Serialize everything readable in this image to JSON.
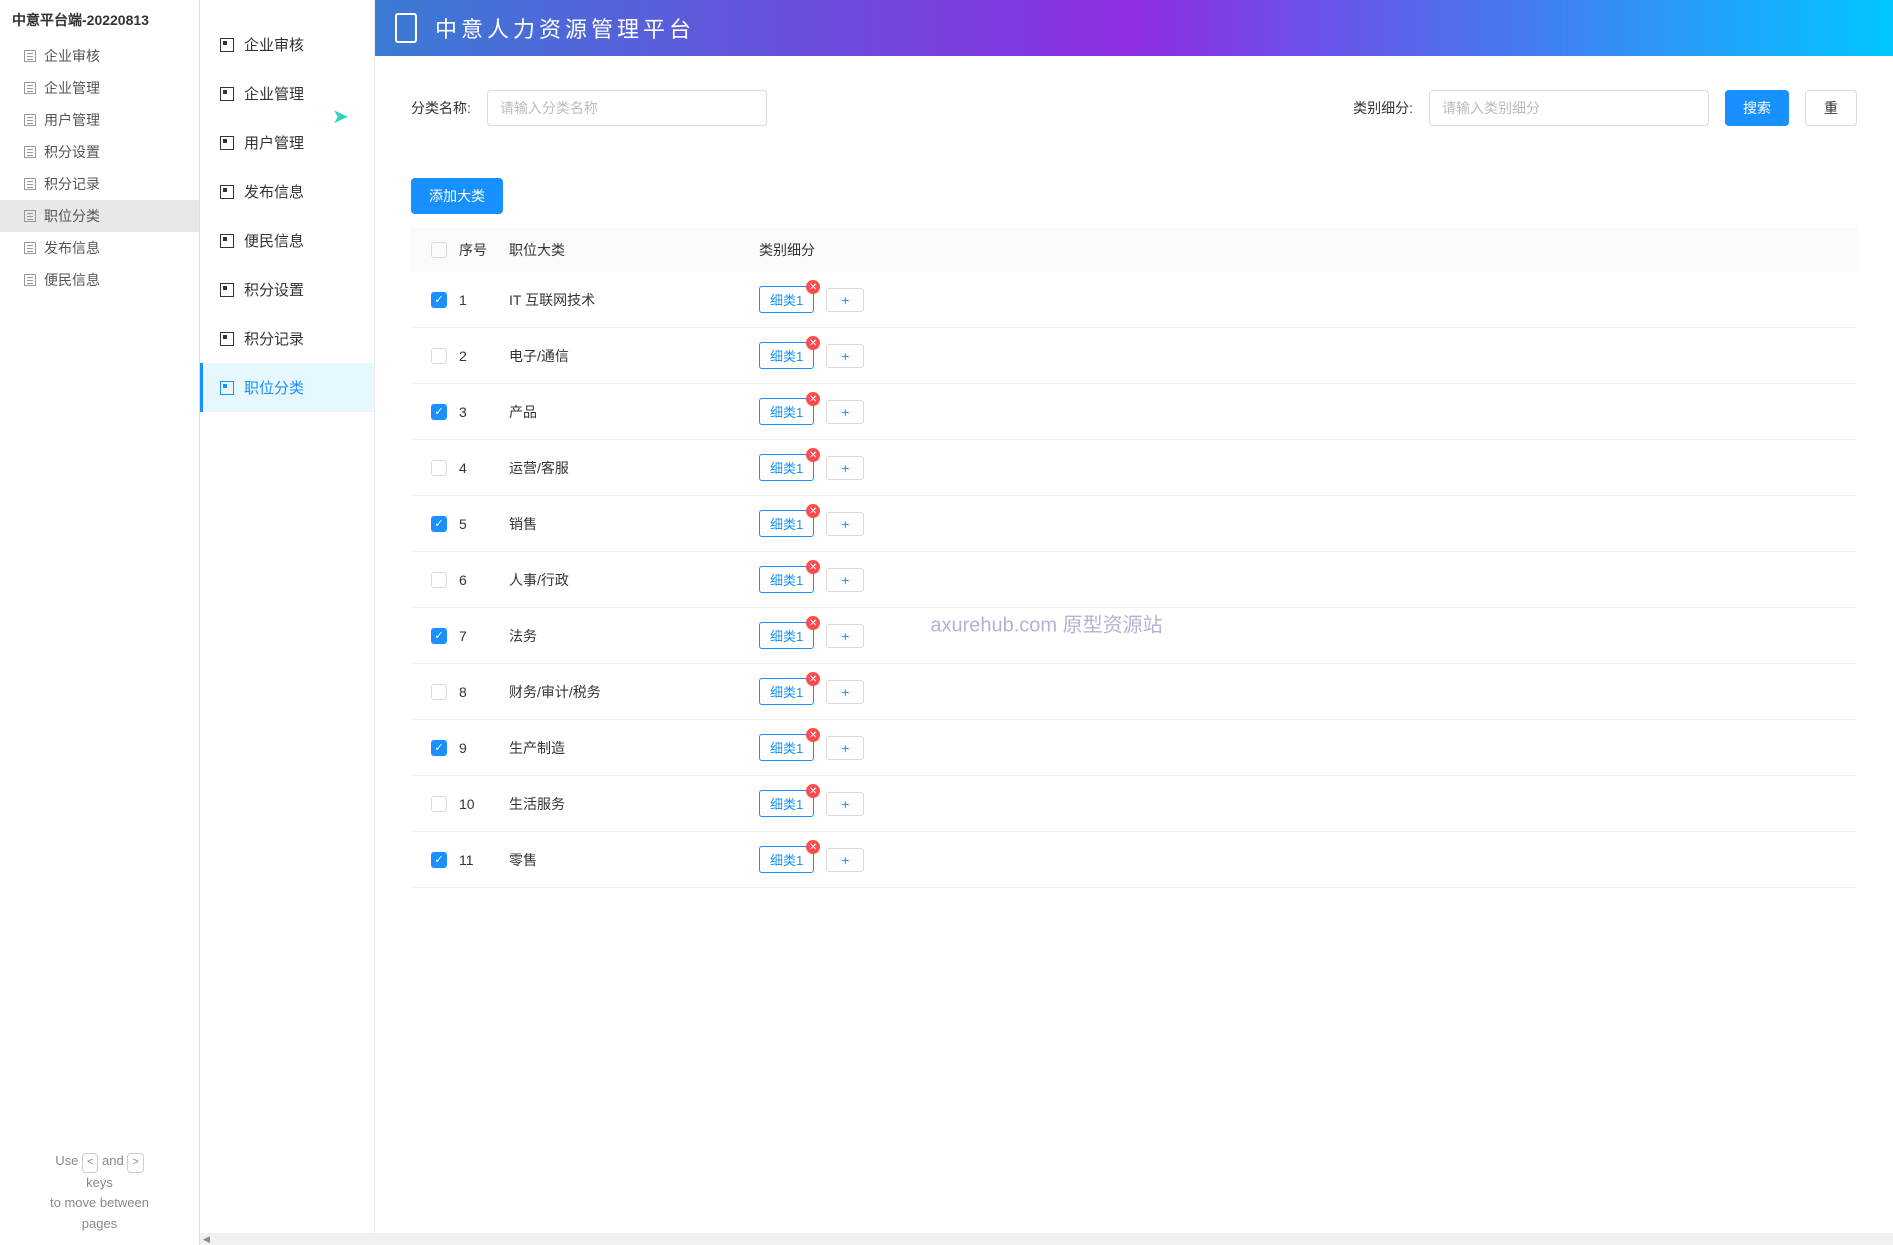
{
  "tree": {
    "title": "中意平台端-20220813",
    "items": [
      {
        "label": "企业审核",
        "active": false
      },
      {
        "label": "企业管理",
        "active": false
      },
      {
        "label": "用户管理",
        "active": false
      },
      {
        "label": "积分设置",
        "active": false
      },
      {
        "label": "积分记录",
        "active": false
      },
      {
        "label": "职位分类",
        "active": true
      },
      {
        "label": "发布信息",
        "active": false
      },
      {
        "label": "便民信息",
        "active": false
      }
    ],
    "hint_use": "Use",
    "hint_and": "and",
    "hint_keys": "keys",
    "hint_move": "to move between",
    "hint_pages": "pages"
  },
  "subnav": [
    {
      "label": "企业审核",
      "active": false
    },
    {
      "label": "企业管理",
      "active": false
    },
    {
      "label": "用户管理",
      "active": false
    },
    {
      "label": "发布信息",
      "active": false
    },
    {
      "label": "便民信息",
      "active": false
    },
    {
      "label": "积分设置",
      "active": false
    },
    {
      "label": "积分记录",
      "active": false
    },
    {
      "label": "职位分类",
      "active": true
    }
  ],
  "header": {
    "title": "中意人力资源管理平台"
  },
  "search": {
    "label1": "分类名称:",
    "placeholder1": "请输入分类名称",
    "label2": "类别细分:",
    "placeholder2": "请输入类别细分",
    "btn_search": "搜索",
    "btn_reset": "重"
  },
  "table": {
    "add_btn": "添加大类",
    "head_idx": "序号",
    "head_cat": "职位大类",
    "head_sub": "类别细分",
    "tag_label": "细类1",
    "add_label": "+",
    "rows": [
      {
        "idx": "1",
        "cat": "IT 互联网技术",
        "checked": true
      },
      {
        "idx": "2",
        "cat": "电子/通信",
        "checked": false
      },
      {
        "idx": "3",
        "cat": "产品",
        "checked": true
      },
      {
        "idx": "4",
        "cat": "运营/客服",
        "checked": false
      },
      {
        "idx": "5",
        "cat": "销售",
        "checked": true
      },
      {
        "idx": "6",
        "cat": "人事/行政",
        "checked": false
      },
      {
        "idx": "7",
        "cat": "法务",
        "checked": true
      },
      {
        "idx": "8",
        "cat": "财务/审计/税务",
        "checked": false
      },
      {
        "idx": "9",
        "cat": "生产制造",
        "checked": true
      },
      {
        "idx": "10",
        "cat": "生活服务",
        "checked": false
      },
      {
        "idx": "11",
        "cat": "零售",
        "checked": true
      }
    ]
  },
  "watermark": "axurehub.com 原型资源站"
}
